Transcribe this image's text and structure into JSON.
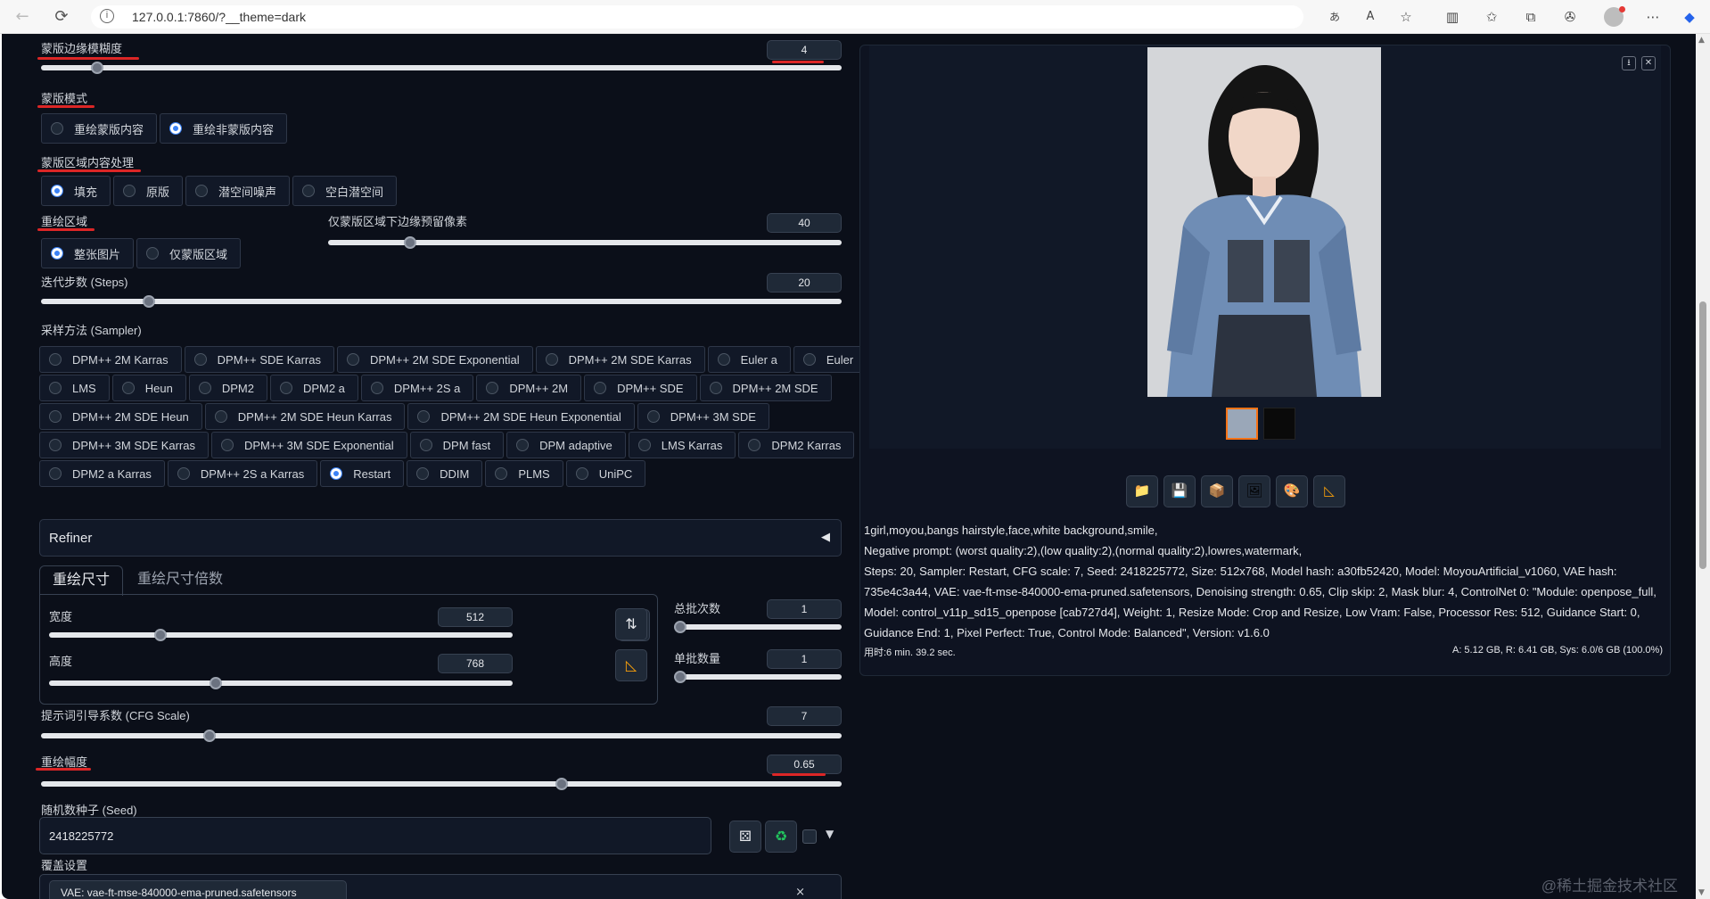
{
  "browser": {
    "url": "127.0.0.1:7860/?__theme=dark"
  },
  "mask_blur": {
    "label": "蒙版边缘模糊度",
    "value": "4",
    "fraction": 0.07
  },
  "mask_mode": {
    "label": "蒙版模式",
    "options": [
      "重绘蒙版内容",
      "重绘非蒙版内容"
    ],
    "selected": 1
  },
  "masked_content": {
    "label": "蒙版区域内容处理",
    "options": [
      "填充",
      "原版",
      "潜空间噪声",
      "空白潜空间"
    ],
    "selected": 0
  },
  "inpaint_area": {
    "label": "重绘区域",
    "options": [
      "整张图片",
      "仅蒙版区域"
    ],
    "selected": 0
  },
  "padding": {
    "label": "仅蒙版区域下边缘预留像素",
    "value": "40",
    "fraction": 0.16
  },
  "steps": {
    "label": "迭代步数 (Steps)",
    "value": "20",
    "fraction": 0.135
  },
  "sampler": {
    "label": "采样方法 (Sampler)",
    "rows": [
      [
        "DPM++ 2M Karras",
        "DPM++ SDE Karras",
        "DPM++ 2M SDE Exponential",
        "DPM++ 2M SDE Karras",
        "Euler a",
        "Euler"
      ],
      [
        "LMS",
        "Heun",
        "DPM2",
        "DPM2 a",
        "DPM++ 2S a",
        "DPM++ 2M",
        "DPM++ SDE",
        "DPM++ 2M SDE"
      ],
      [
        "DPM++ 2M SDE Heun",
        "DPM++ 2M SDE Heun Karras",
        "DPM++ 2M SDE Heun Exponential",
        "DPM++ 3M SDE"
      ],
      [
        "DPM++ 3M SDE Karras",
        "DPM++ 3M SDE Exponential",
        "DPM fast",
        "DPM adaptive",
        "LMS Karras",
        "DPM2 Karras"
      ],
      [
        "DPM2 a Karras",
        "DPM++ 2S a Karras",
        "Restart",
        "DDIM",
        "PLMS",
        "UniPC"
      ]
    ],
    "selected": "Restart"
  },
  "refiner": {
    "label": "Refiner",
    "arrow": "◀"
  },
  "size_tabs": [
    "重绘尺寸",
    "重绘尺寸倍数"
  ],
  "width": {
    "label": "宽度",
    "value": "512",
    "fraction": 0.24
  },
  "height": {
    "label": "高度",
    "value": "768",
    "fraction": 0.36
  },
  "batch_count": {
    "label": "总批次数",
    "value": "1",
    "fraction": 0.0
  },
  "batch_size": {
    "label": "单批数量",
    "value": "1",
    "fraction": 0.0
  },
  "cfg": {
    "label": "提示词引导系数 (CFG Scale)",
    "value": "7",
    "fraction": 0.21
  },
  "denoise": {
    "label": "重绘幅度",
    "value": "0.65",
    "fraction": 0.65
  },
  "seed": {
    "label": "随机数种子 (Seed)",
    "value": "2418225772"
  },
  "override": {
    "label": "覆盖设置",
    "chip": "VAE: vae-ft-mse-840000-ema-pruned.safetensors"
  },
  "output": {
    "info_lines": [
      "1girl,moyou,bangs hairstyle,face,white background,smile,",
      "Negative prompt: (worst quality:2),(low quality:2),(normal quality:2),lowres,watermark,",
      "Steps: 20, Sampler: Restart, CFG scale: 7, Seed: 2418225772, Size: 512x768, Model hash: a30fb52420, Model: MoyouArtificial_v1060, VAE hash:",
      "735e4c3a44, VAE: vae-ft-mse-840000-ema-pruned.safetensors, Denoising strength: 0.65, Clip skip: 2, Mask blur: 4, ControlNet 0: \"Module: openpose_full,",
      "Model: control_v11p_sd15_openpose [cab727d4], Weight: 1, Resize Mode: Crop and Resize, Low Vram: False, Processor Res: 512, Guidance Start: 0,",
      "Guidance End: 1, Pixel Perfect: True, Control Mode: Balanced\", Version: v1.6.0"
    ],
    "time": "用时:6 min. 39.2 sec.",
    "memory": "A: 5.12 GB, R: 6.41 GB, Sys: 6.0/6 GB (100.0%)"
  },
  "watermark": "@稀土掘金技术社区",
  "colors": {
    "accent": "#3b82f6",
    "annotation": "#dc2626",
    "thumb_border": "#f97316"
  }
}
